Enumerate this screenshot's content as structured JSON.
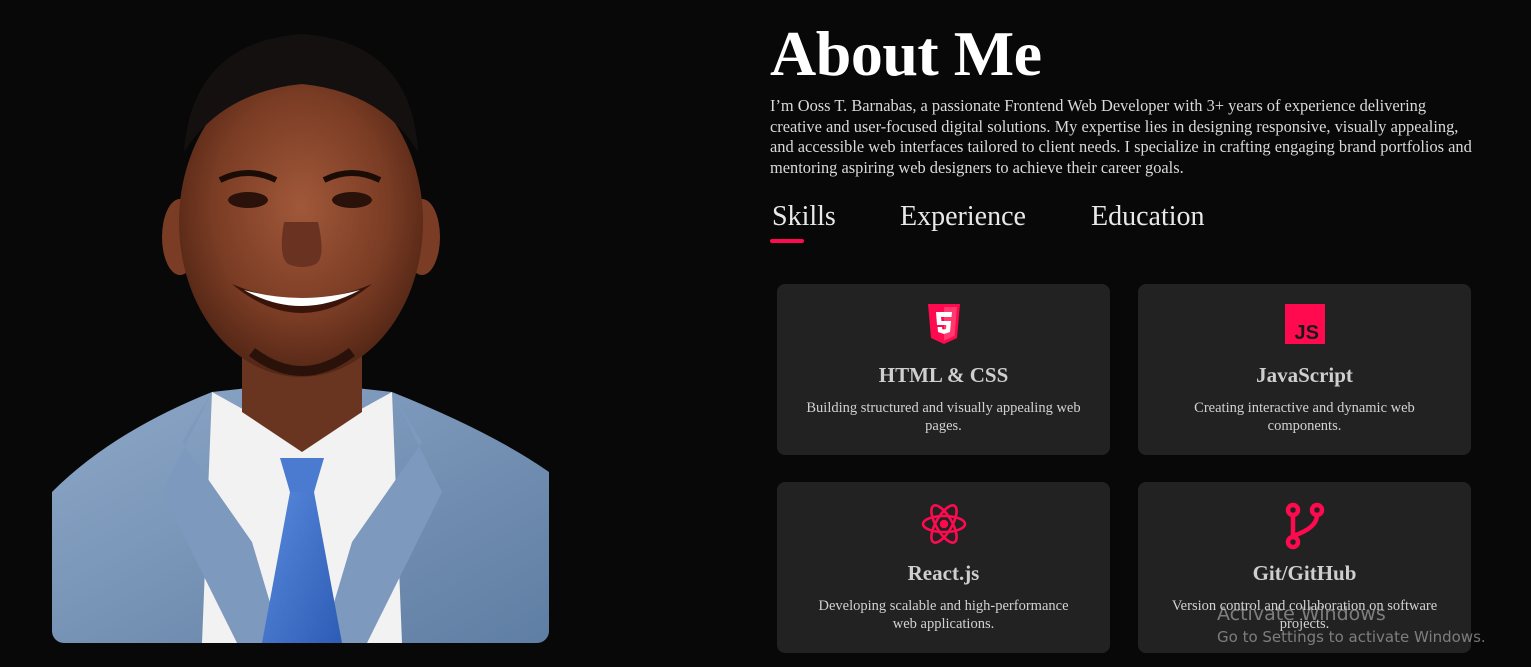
{
  "about": {
    "heading": "About Me",
    "bio": "I’m Ooss T. Barnabas, a passionate Frontend Web Developer with 3+ years of experience delivering creative and user-focused digital solutions. My expertise lies in designing responsive, visually appealing, and accessible web interfaces tailored to client needs. I specialize in crafting engaging brand portfolios and mentoring aspiring web designers to achieve their career goals."
  },
  "tabs": [
    {
      "label": "Skills",
      "active": true
    },
    {
      "label": "Experience",
      "active": false
    },
    {
      "label": "Education",
      "active": false
    }
  ],
  "skills": [
    {
      "icon": "html5-icon",
      "title": "HTML & CSS",
      "description": "Building structured and visually appealing web pages."
    },
    {
      "icon": "javascript-icon",
      "title": "JavaScript",
      "description": "Creating interactive and dynamic web components."
    },
    {
      "icon": "react-icon",
      "title": "React.js",
      "description": "Developing scalable and high-performance web applications."
    },
    {
      "icon": "git-branch-icon",
      "title": "Git/GitHub",
      "description": "Version control and collaboration on software projects."
    }
  ],
  "js_badge_text": "JS",
  "watermark": {
    "line1": "Activate Windows",
    "line2": "Go to Settings to activate Windows."
  },
  "colors": {
    "background": "#080808",
    "accent": "#ff0a4f",
    "card": "#222222"
  }
}
